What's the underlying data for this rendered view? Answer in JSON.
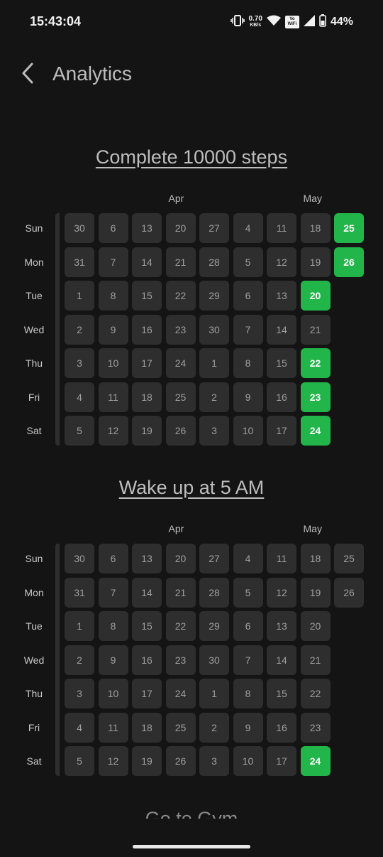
{
  "status_bar": {
    "time": "15:43:04",
    "net_speed_value": "0.70",
    "net_speed_unit": "KB/s",
    "vowifi_top": "Vo",
    "vowifi_bottom": "WiFi",
    "battery_percent": "44%"
  },
  "header": {
    "title": "Analytics",
    "back_icon": "chevron-left-icon"
  },
  "day_labels": [
    "Sun",
    "Mon",
    "Tue",
    "Wed",
    "Thu",
    "Fri",
    "Sat"
  ],
  "colors": {
    "done": "#22b54a",
    "cell": "#2e2e2e",
    "background": "#141414"
  },
  "habits": [
    {
      "title": "Complete 10000 steps",
      "months": [
        {
          "label": "Apr",
          "col": 3
        },
        {
          "label": "May",
          "col": 7
        }
      ],
      "columns": [
        [
          30,
          31,
          1,
          2,
          3,
          4,
          5
        ],
        [
          6,
          7,
          8,
          9,
          10,
          11,
          12
        ],
        [
          13,
          14,
          15,
          16,
          17,
          18,
          19
        ],
        [
          20,
          21,
          22,
          23,
          24,
          25,
          26
        ],
        [
          27,
          28,
          29,
          30,
          1,
          2,
          3
        ],
        [
          4,
          5,
          6,
          7,
          8,
          9,
          10
        ],
        [
          11,
          12,
          13,
          14,
          15,
          16,
          17
        ],
        [
          18,
          19,
          20,
          21,
          22,
          23,
          24
        ],
        [
          25,
          26
        ]
      ],
      "completed": [
        [
          7,
          2
        ],
        [
          7,
          4
        ],
        [
          7,
          5
        ],
        [
          7,
          6
        ],
        [
          8,
          0
        ],
        [
          8,
          1
        ]
      ]
    },
    {
      "title": "Wake up at 5 AM",
      "months": [
        {
          "label": "Apr",
          "col": 3
        },
        {
          "label": "May",
          "col": 7
        }
      ],
      "columns": [
        [
          30,
          31,
          1,
          2,
          3,
          4,
          5
        ],
        [
          6,
          7,
          8,
          9,
          10,
          11,
          12
        ],
        [
          13,
          14,
          15,
          16,
          17,
          18,
          19
        ],
        [
          20,
          21,
          22,
          23,
          24,
          25,
          26
        ],
        [
          27,
          28,
          29,
          30,
          1,
          2,
          3
        ],
        [
          4,
          5,
          6,
          7,
          8,
          9,
          10
        ],
        [
          11,
          12,
          13,
          14,
          15,
          16,
          17
        ],
        [
          18,
          19,
          20,
          21,
          22,
          23,
          24
        ],
        [
          25,
          26
        ]
      ],
      "completed": [
        [
          7,
          6
        ]
      ]
    }
  ],
  "next_habit_title": "Go to Gym"
}
